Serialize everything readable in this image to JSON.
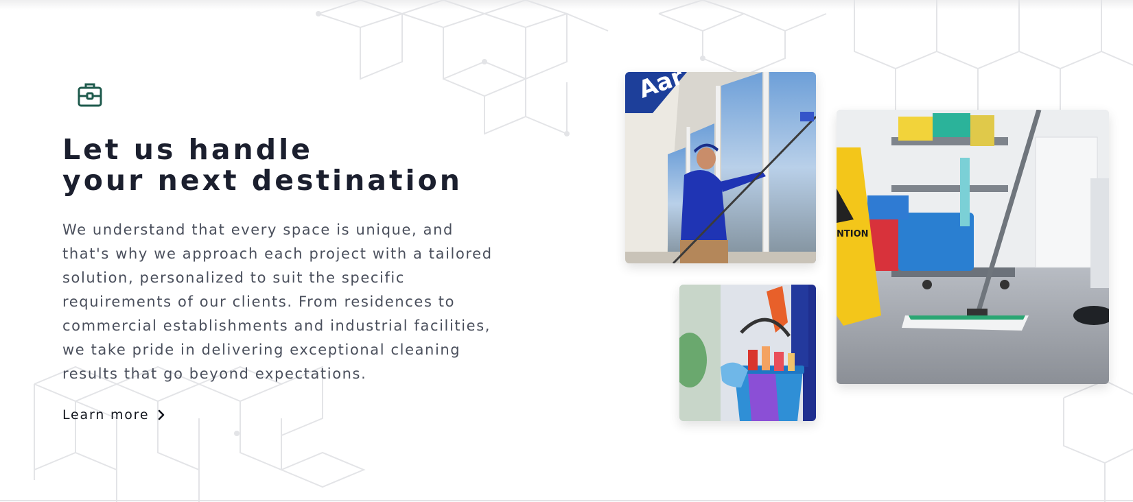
{
  "section": {
    "icon": "briefcase-icon",
    "heading_line1": "Let us handle",
    "heading_line2": "your next destination",
    "body": "We understand that every space is unique, and that's why we approach each project with a tailored solution, personalized to suit the specific requirements of our clients. From residences to commercial establishments and industrial facilities, we take pride in delivering exceptional cleaning results that go beyond expectations.",
    "link_label": "Learn more",
    "link_icon": "chevron-right-icon"
  },
  "gallery": {
    "photos": [
      {
        "name": "window-cleaner-photo"
      },
      {
        "name": "cleaning-bucket-photo"
      },
      {
        "name": "mop-cart-photo",
        "sign_text": "NTION"
      }
    ]
  },
  "colors": {
    "heading": "#1b1f2e",
    "body": "#4a4f5c",
    "icon": "#1e5a4c",
    "pattern": "#e3e4e7"
  }
}
